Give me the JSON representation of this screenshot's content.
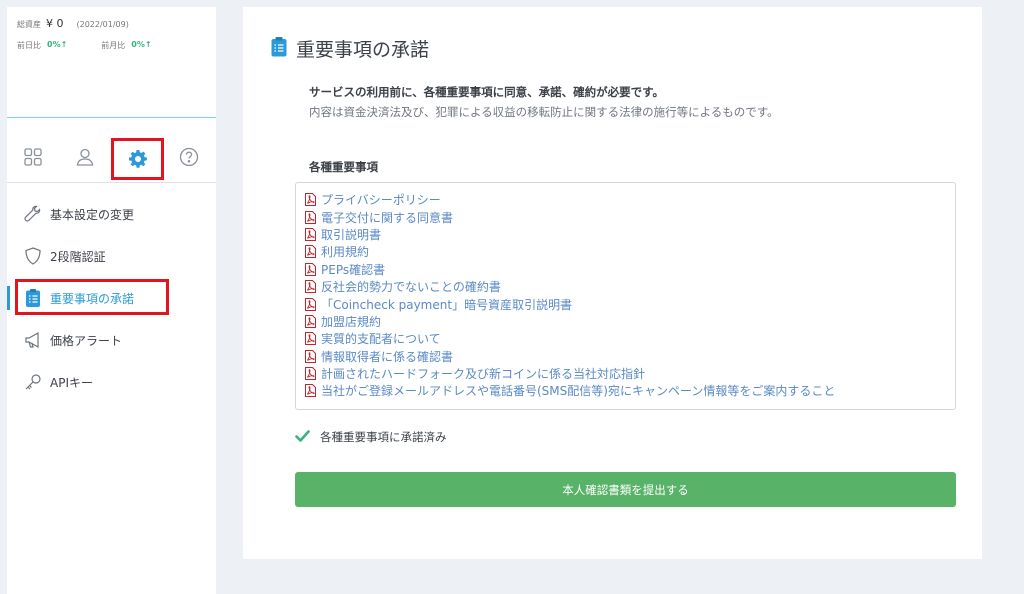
{
  "sidebar": {
    "assets_label": "総資産",
    "assets_value": "¥ 0",
    "assets_date": "(2022/01/09)",
    "prev_day_label": "前日比",
    "prev_day_value": "0%↑",
    "prev_month_label": "前月比",
    "prev_month_value": "0%↑",
    "menu": [
      {
        "label": "基本設定の変更",
        "icon": "wrench-icon"
      },
      {
        "label": "2段階認証",
        "icon": "shield-icon"
      },
      {
        "label": "重要事項の承諾",
        "icon": "clipboard-icon"
      },
      {
        "label": "価格アラート",
        "icon": "megaphone-icon"
      },
      {
        "label": "APIキー",
        "icon": "key-icon"
      }
    ]
  },
  "main": {
    "title": "重要事項の承諾",
    "intro_bold": "サービスの利用前に、各種重要事項に同意、承諾、確約が必要です。",
    "intro_text": "内容は資金決済法及び、犯罪による収益の移転防止に関する法律の施行等によるものです。",
    "list_heading": "各種重要事項",
    "documents": [
      "プライバシーポリシー",
      "電子交付に関する同意書",
      "取引説明書",
      "利用規約",
      "PEPs確認書",
      "反社会的勢力でないことの確約書",
      "「Coincheck payment」暗号資産取引説明書",
      "加盟店規約",
      "実質的支配者について",
      "情報取得者に係る確認書",
      "計画されたハードフォーク及び新コインに係る当社対応指針",
      "当社がご登録メールアドレスや電話番号(SMS配信等)宛にキャンペーン情報等をご案内すること"
    ],
    "agreed_text": "各種重要事項に承諾済み",
    "submit_label": "本人確認書類を提出する"
  },
  "colors": {
    "accent": "#2c9ad8",
    "highlight": "#e2141e",
    "submit": "#58b368",
    "link": "#5a8ac6",
    "check": "#36b37e"
  }
}
